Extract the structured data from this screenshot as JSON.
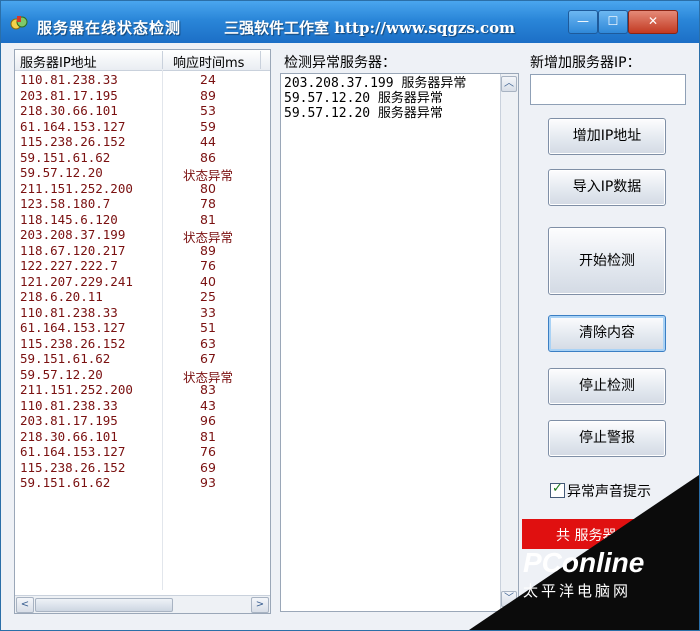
{
  "window": {
    "title": "服务器在线状态检测",
    "studio_url": "三强软件工作室 http://www.sqgzs.com",
    "minimize_glyph": "—",
    "maximize_glyph": "☐",
    "close_glyph": "✕"
  },
  "server_list": {
    "columns": [
      "服务器IP地址",
      "响应时间ms"
    ],
    "rows": [
      {
        "ip": "110.81.238.33",
        "ms": "24"
      },
      {
        "ip": "203.81.17.195",
        "ms": "89"
      },
      {
        "ip": "218.30.66.101",
        "ms": "53"
      },
      {
        "ip": "61.164.153.127",
        "ms": "59"
      },
      {
        "ip": "115.238.26.152",
        "ms": "44"
      },
      {
        "ip": "59.151.61.62",
        "ms": "86"
      },
      {
        "ip": "59.57.12.20",
        "ms": "状态异常"
      },
      {
        "ip": "211.151.252.200",
        "ms": "80"
      },
      {
        "ip": "123.58.180.7",
        "ms": "78"
      },
      {
        "ip": "118.145.6.120",
        "ms": "81"
      },
      {
        "ip": "203.208.37.199",
        "ms": "状态异常"
      },
      {
        "ip": "118.67.120.217",
        "ms": "89"
      },
      {
        "ip": "122.227.222.7",
        "ms": "76"
      },
      {
        "ip": "121.207.229.241",
        "ms": "40"
      },
      {
        "ip": "218.6.20.11",
        "ms": "25"
      },
      {
        "ip": "110.81.238.33",
        "ms": "33"
      },
      {
        "ip": "61.164.153.127",
        "ms": "51"
      },
      {
        "ip": "115.238.26.152",
        "ms": "63"
      },
      {
        "ip": "59.151.61.62",
        "ms": "67"
      },
      {
        "ip": "59.57.12.20",
        "ms": "状态异常"
      },
      {
        "ip": "211.151.252.200",
        "ms": "83"
      },
      {
        "ip": "110.81.238.33",
        "ms": "43"
      },
      {
        "ip": "203.81.17.195",
        "ms": "96"
      },
      {
        "ip": "218.30.66.101",
        "ms": "81"
      },
      {
        "ip": "61.164.153.127",
        "ms": "76"
      },
      {
        "ip": "115.238.26.152",
        "ms": "69"
      },
      {
        "ip": "59.151.61.62",
        "ms": "93"
      }
    ],
    "scroll_left": "<",
    "scroll_right": ">"
  },
  "abnormal": {
    "label": "检测异常服务器：",
    "lines": [
      "203.208.37.199 服务器异常",
      "59.57.12.20 服务器异常",
      "59.57.12.20 服务器异常"
    ],
    "scroll_up": "︿",
    "scroll_down": "﹀"
  },
  "new_ip": {
    "label": "新增加服务器IP：",
    "value": ""
  },
  "buttons": {
    "add_ip": "增加IP地址",
    "import": "导入IP数据",
    "start": "开始检测",
    "clear": "清除内容",
    "stop": "停止检测",
    "stop_alarm": "停止警报"
  },
  "sound_alert": {
    "label": "异常声音提示",
    "checked": true,
    "mark": "✓"
  },
  "status": {
    "text": "共 服务器",
    "color": "#e01010"
  },
  "watermark": {
    "brand": "PConline",
    "sub": "太平洋电脑网"
  }
}
